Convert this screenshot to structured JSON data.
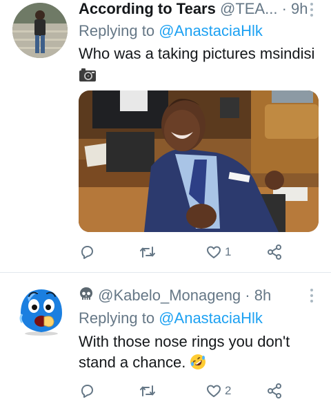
{
  "tweets": [
    {
      "author_name": "According to Tears",
      "handle": "@TEA...",
      "separator": "·",
      "time": "9h",
      "replying_prefix": "Replying to",
      "replying_to": "@AnastaciaHlk",
      "text": "Who was a taking pictures msindisi",
      "emoji": "camera-emoji",
      "media": "photo-man-laughing-in-parliament",
      "actions": {
        "reply_count": "",
        "retweet_count": "",
        "like_count": "1"
      }
    },
    {
      "author_prefix_icon": "skull-emoji",
      "handle": "@Kabelo_Monageng",
      "separator": "·",
      "time": "8h",
      "replying_prefix": "Replying to",
      "replying_to": "@AnastaciaHlk",
      "text": "With those nose rings you don't stand a chance.",
      "emoji": "rolling-on-floor-laughing-emoji",
      "actions": {
        "reply_count": "",
        "retweet_count": "",
        "like_count": "2"
      }
    }
  ],
  "colors": {
    "text": "#14171a",
    "secondary": "#657786",
    "link": "#1da1f2",
    "divider": "#e1e8ed"
  }
}
